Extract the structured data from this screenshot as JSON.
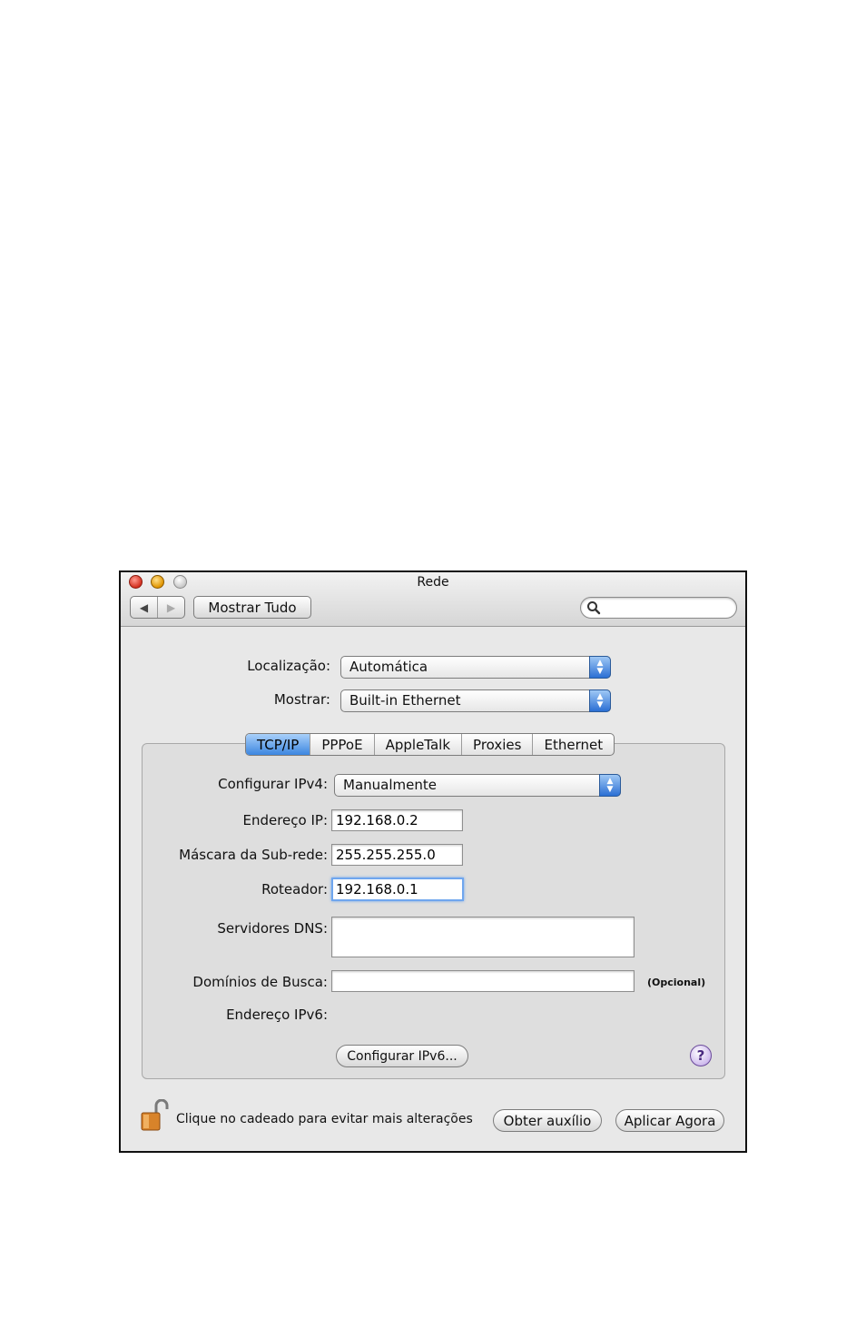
{
  "window": {
    "title": "Rede",
    "nav_back": "◀",
    "nav_forward": "▶",
    "show_all_label": "Mostrar Tudo",
    "search": {
      "value": "",
      "placeholder": ""
    }
  },
  "location": {
    "label": "Localização:",
    "value": "Automática"
  },
  "show": {
    "label": "Mostrar:",
    "value": "Built-in Ethernet"
  },
  "tabs": [
    {
      "label": "TCP/IP",
      "selected": true
    },
    {
      "label": "PPPoE",
      "selected": false
    },
    {
      "label": "AppleTalk",
      "selected": false
    },
    {
      "label": "Proxies",
      "selected": false
    },
    {
      "label": "Ethernet",
      "selected": false
    }
  ],
  "tcpip": {
    "configure_ipv4": {
      "label": "Configurar IPv4:",
      "value": "Manualmente"
    },
    "ip_address": {
      "label": "Endereço IP:",
      "value": "192.168.0.2"
    },
    "subnet_mask": {
      "label": "Máscara da Sub-rede:",
      "value": "255.255.255.0"
    },
    "router": {
      "label": "Roteador:",
      "value": "192.168.0.1"
    },
    "dns_servers": {
      "label": "Servidores DNS:",
      "value": ""
    },
    "search_domains": {
      "label": "Domínios de Busca:",
      "value": "",
      "note": "(Opcional)"
    },
    "ipv6_address": {
      "label": "Endereço IPv6:",
      "value": ""
    },
    "configure_ipv6_button": "Configurar IPv6..."
  },
  "help_label": "?",
  "footer": {
    "lock_message": "Clique no cadeado para evitar mais alterações",
    "assist_button": "Obter auxílio",
    "apply_button": "Aplicar Agora"
  },
  "colors": {
    "accent_blue": "#3c86e0",
    "window_bg": "#e8e8e8"
  }
}
